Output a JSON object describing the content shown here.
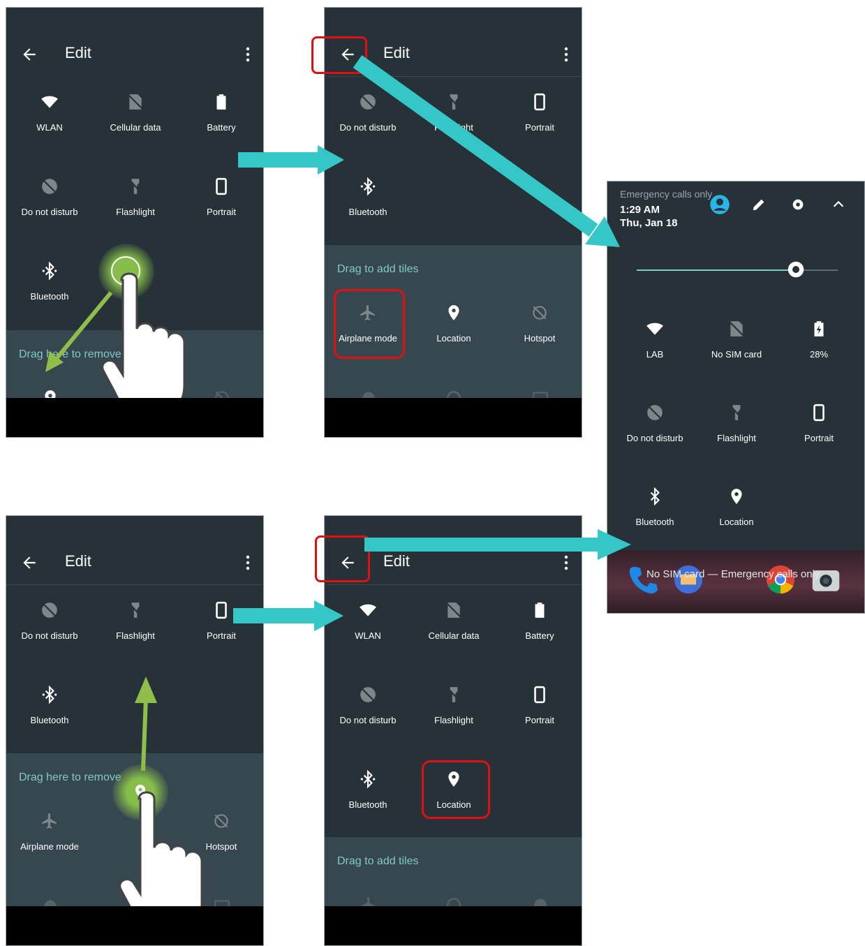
{
  "screen1": {
    "title": "Edit",
    "tiles": [
      "WLAN",
      "Cellular data",
      "Battery",
      "Do not disturb",
      "Flashlight",
      "Portrait",
      "Bluetooth"
    ],
    "tray_title": "Drag here to remove"
  },
  "screen2": {
    "title": "Edit",
    "tiles": [
      "Do not disturb",
      "Flashlight",
      "Portrait",
      "Bluetooth"
    ],
    "tray_title": "Drag to add tiles",
    "tray_tiles": [
      "Airplane mode",
      "Location",
      "Hotspot"
    ]
  },
  "screen3": {
    "status": "Emergency calls only",
    "time": "1:29 AM",
    "date": "Thu, Jan 18",
    "brightness": 0.79,
    "tiles": [
      "LAB",
      "No SIM card",
      "28%",
      "Do not disturb",
      "Flashlight",
      "Portrait",
      "Bluetooth",
      "Location"
    ],
    "bottom_text": "No SIM card — Emergency calls only"
  },
  "screen4": {
    "title": "Edit",
    "tiles": [
      "Do not disturb",
      "Flashlight",
      "Portrait",
      "Bluetooth"
    ],
    "tray_title": "Drag here to remove",
    "tray_tiles": [
      "Airplane mode",
      "Hotspot"
    ]
  },
  "screen5": {
    "title": "Edit",
    "tiles": [
      "WLAN",
      "Cellular data",
      "Battery",
      "Do not disturb",
      "Flashlight",
      "Portrait",
      "Bluetooth",
      "Location"
    ],
    "tray_title": "Drag to add tiles"
  },
  "colors": {
    "background": "#263238",
    "tray": "#37474f",
    "accent": "#80cbc4",
    "arrow_teal": "#35c6c8",
    "arrow_green": "#8fbf4a",
    "highlight": "#e01010"
  }
}
